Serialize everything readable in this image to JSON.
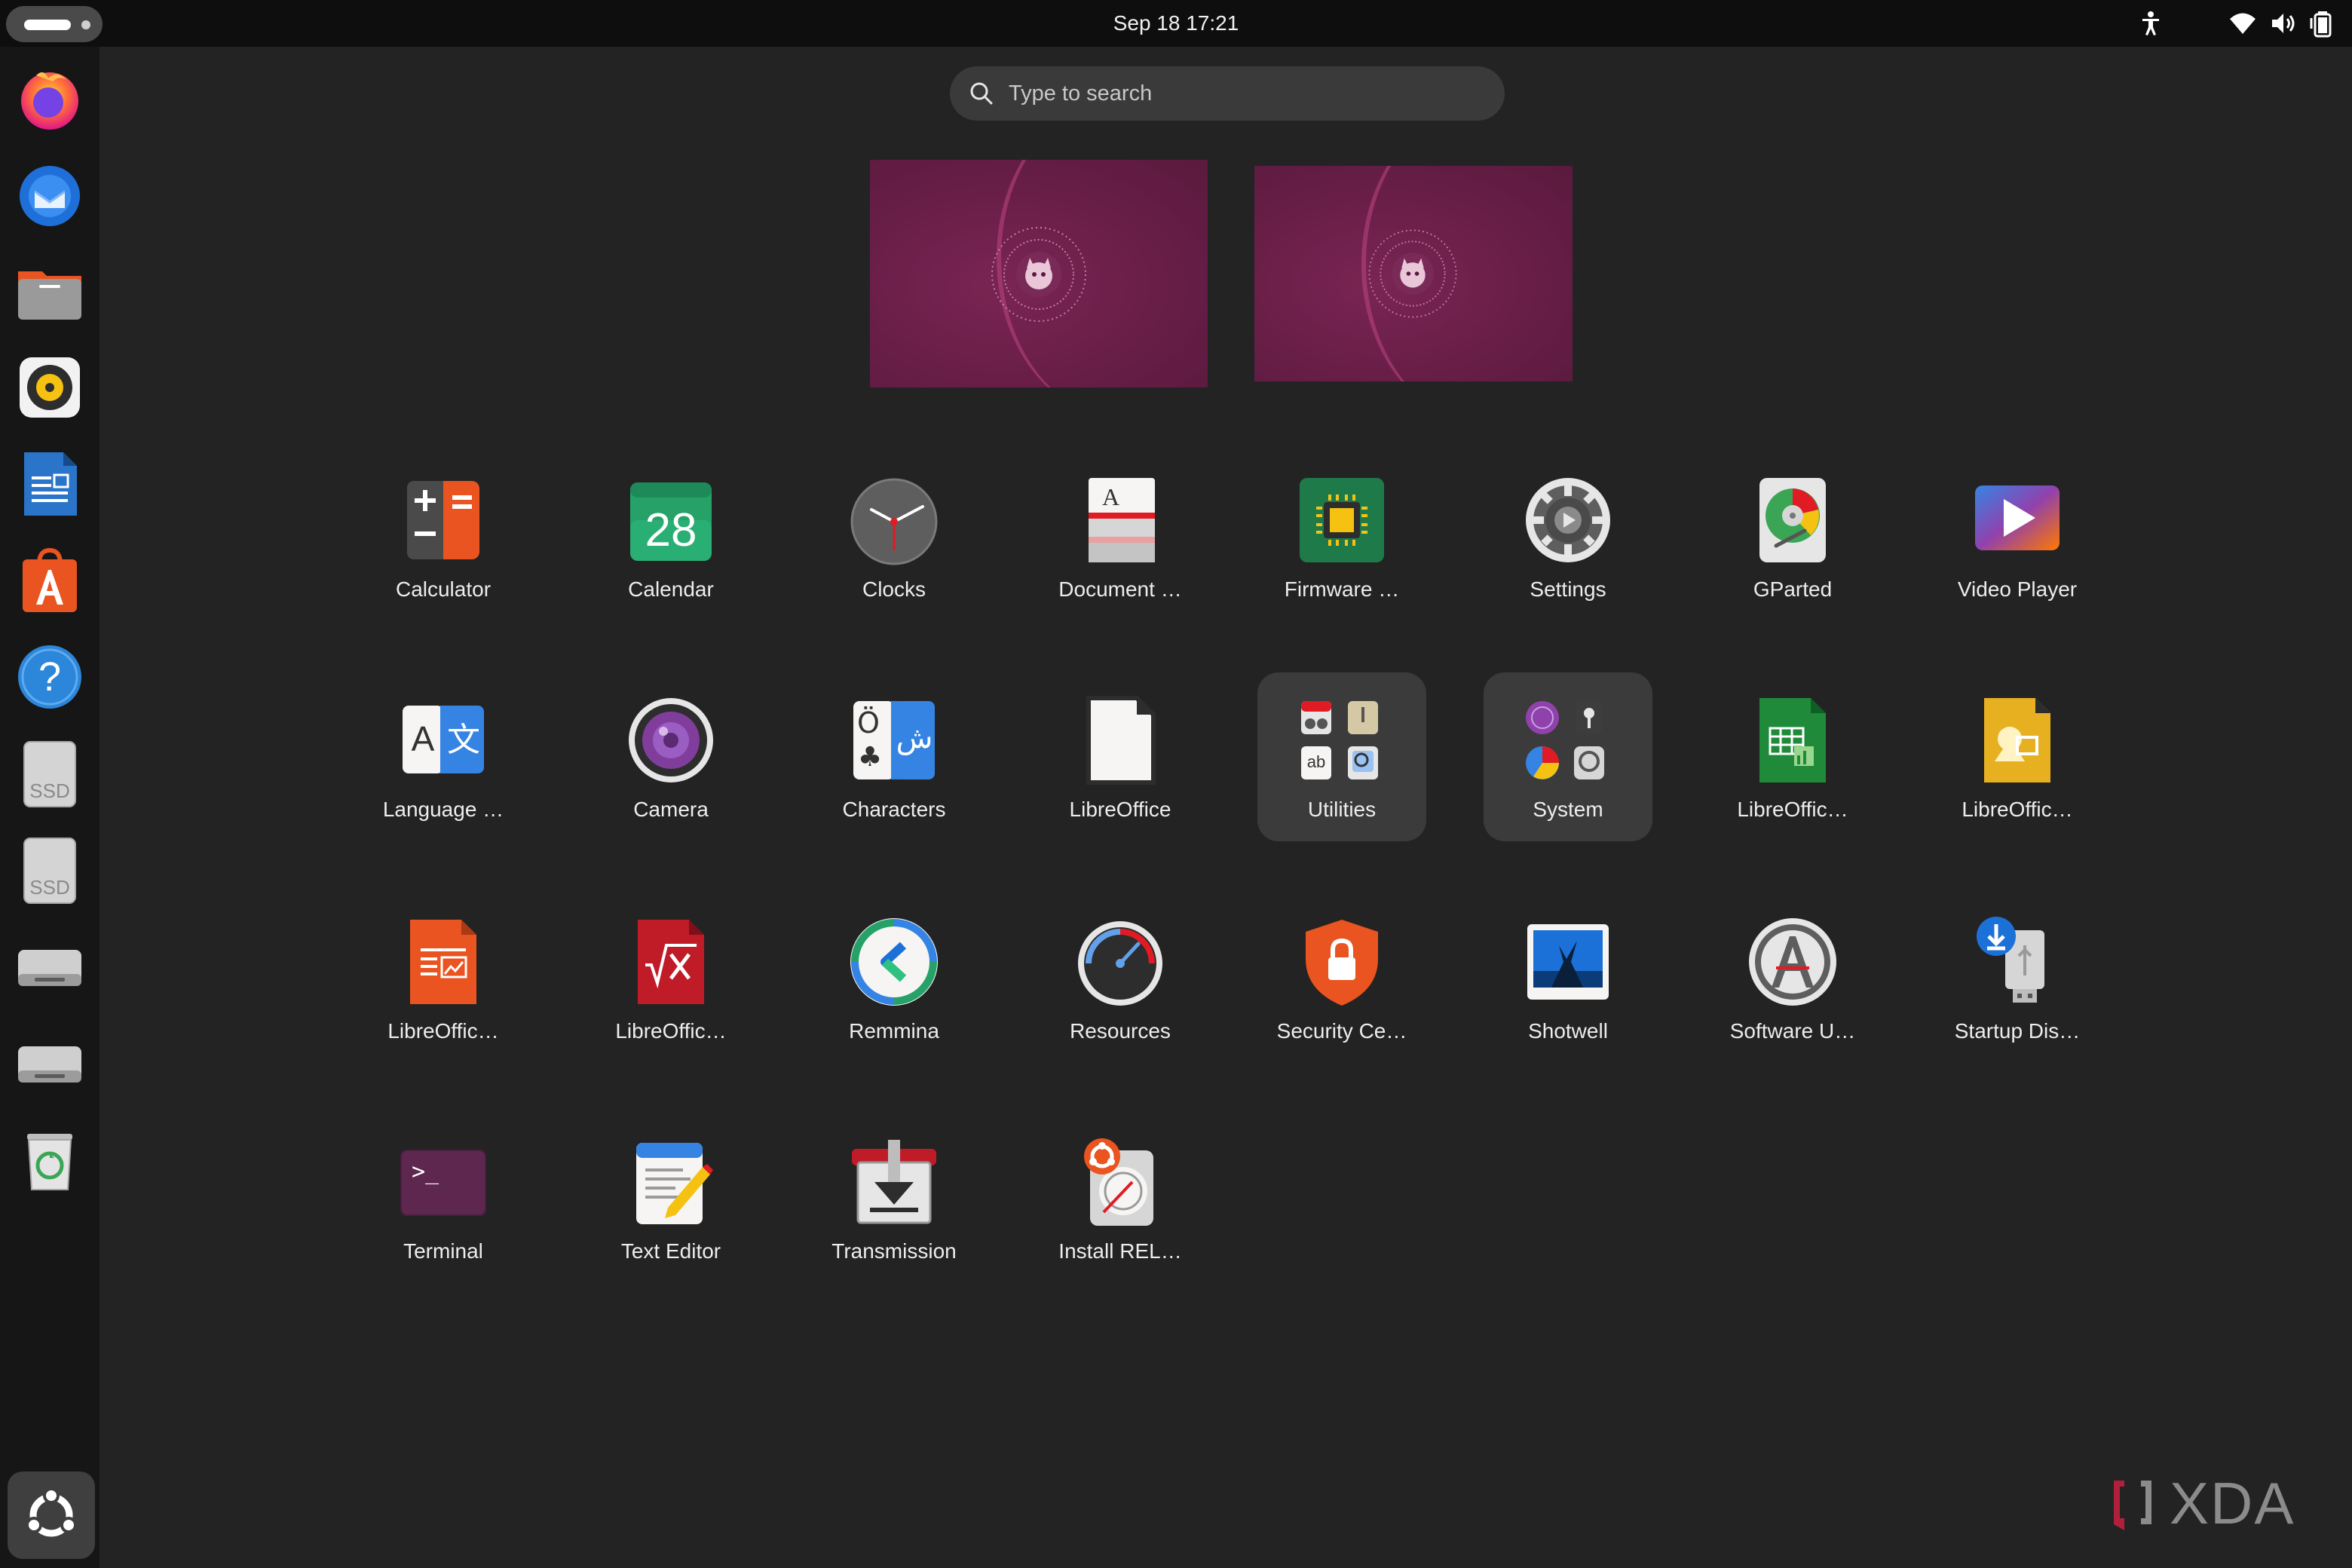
{
  "topbar": {
    "activities": "activities-indicator",
    "datetime": "Sep 18  17:21",
    "tray_icons": [
      "accessibility-icon",
      "wifi-icon",
      "volume-icon",
      "battery-icon"
    ]
  },
  "search": {
    "placeholder": "Type to search"
  },
  "workspaces": [
    {
      "name": "workspace-1"
    },
    {
      "name": "workspace-2"
    }
  ],
  "dock": {
    "items": [
      {
        "name": "Firefox",
        "icon": "firefox-icon"
      },
      {
        "name": "Thunderbird",
        "icon": "thunderbird-icon"
      },
      {
        "name": "Files",
        "icon": "files-icon"
      },
      {
        "name": "Rhythmbox",
        "icon": "rhythmbox-icon"
      },
      {
        "name": "LibreOffice Writer",
        "icon": "writer-icon"
      },
      {
        "name": "App Center",
        "icon": "app-center-icon"
      },
      {
        "name": "Help",
        "icon": "help-icon"
      },
      {
        "name": "SSD",
        "icon": "ssd-drive-icon",
        "text": "SSD"
      },
      {
        "name": "SSD",
        "icon": "ssd-drive-icon",
        "text": "SSD"
      },
      {
        "name": "Drive",
        "icon": "drive-icon"
      },
      {
        "name": "Drive",
        "icon": "drive-icon"
      },
      {
        "name": "Trash",
        "icon": "trash-icon"
      }
    ],
    "show_apps": "show-apps-icon"
  },
  "apps": [
    {
      "label": "Calculator",
      "icon": "calculator-icon"
    },
    {
      "label": "Calendar",
      "icon": "calendar-icon",
      "icon_text": "28"
    },
    {
      "label": "Clocks",
      "icon": "clock-icon"
    },
    {
      "label": "Document …",
      "icon": "document-viewer-icon",
      "icon_text": "A"
    },
    {
      "label": "Firmware …",
      "icon": "firmware-icon"
    },
    {
      "label": "Settings",
      "icon": "settings-gear-icon"
    },
    {
      "label": "GParted",
      "icon": "gparted-icon"
    },
    {
      "label": "Video Player",
      "icon": "video-player-icon"
    },
    {
      "label": "Language …",
      "icon": "language-icon",
      "icon_text": "A",
      "icon_text2": "文"
    },
    {
      "label": "Camera",
      "icon": "camera-icon"
    },
    {
      "label": "Characters",
      "icon": "characters-icon",
      "icon_text": "Ö",
      "icon_text2": "ش"
    },
    {
      "label": "LibreOffice",
      "icon": "libreoffice-icon"
    },
    {
      "label": "Utilities",
      "icon": "utilities-folder-icon",
      "folder": true
    },
    {
      "label": "System",
      "icon": "system-folder-icon",
      "folder": true
    },
    {
      "label": "LibreOffic…",
      "icon": "libreoffice-calc-icon"
    },
    {
      "label": "LibreOffic…",
      "icon": "libreoffice-draw-icon"
    },
    {
      "label": "LibreOffic…",
      "icon": "libreoffice-impress-icon"
    },
    {
      "label": "LibreOffic…",
      "icon": "libreoffice-math-icon"
    },
    {
      "label": "Remmina",
      "icon": "remmina-icon"
    },
    {
      "label": "Resources",
      "icon": "resources-icon"
    },
    {
      "label": "Security Ce…",
      "icon": "security-center-icon"
    },
    {
      "label": "Shotwell",
      "icon": "shotwell-icon"
    },
    {
      "label": "Software U…",
      "icon": "software-updater-icon"
    },
    {
      "label": "Startup Dis…",
      "icon": "startup-disk-creator-icon"
    },
    {
      "label": "Terminal",
      "icon": "terminal-icon",
      "icon_text": ">_"
    },
    {
      "label": "Text Editor",
      "icon": "text-editor-icon"
    },
    {
      "label": "Transmission",
      "icon": "transmission-icon"
    },
    {
      "label": "Install REL…",
      "icon": "install-release-icon"
    }
  ],
  "watermark": {
    "text": "XDA",
    "logo": "xda-logo"
  }
}
